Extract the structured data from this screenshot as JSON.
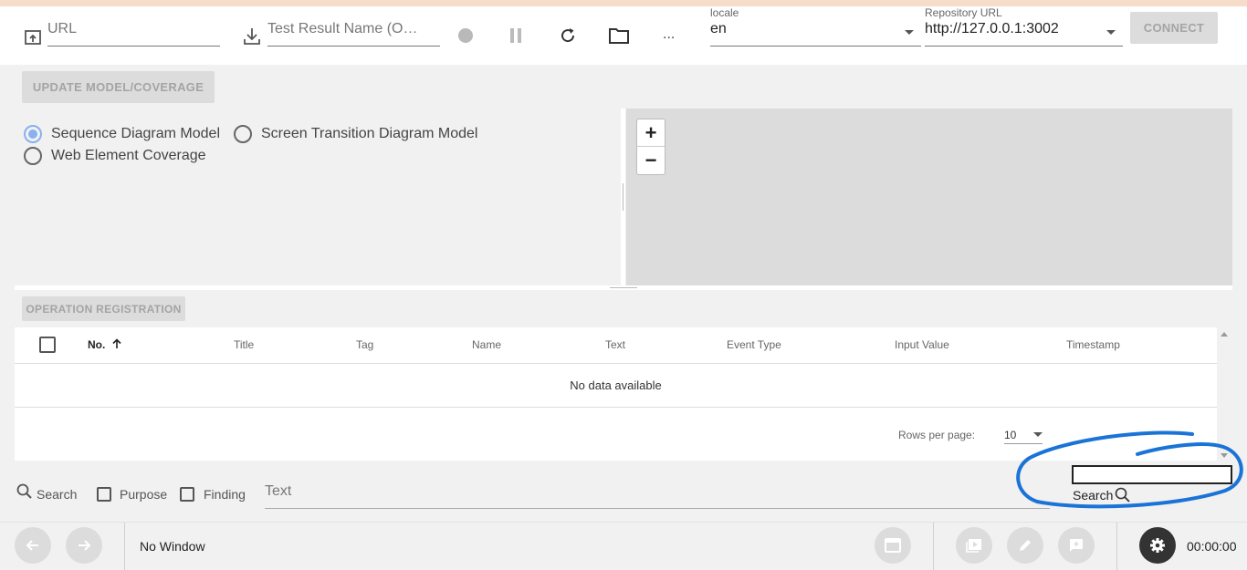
{
  "toolbar": {
    "url_placeholder": "URL",
    "test_result_placeholder": "Test Result Name  (O…",
    "more_label": "...",
    "locale_label": "locale",
    "locale_value": "en",
    "repo_label": "Repository URL",
    "repo_value": "http://127.0.0.1:3002",
    "connect_label": "CONNECT"
  },
  "model": {
    "update_label": "UPDATE MODEL/COVERAGE",
    "options": [
      {
        "label": "Sequence Diagram Model",
        "checked": true
      },
      {
        "label": "Screen Transition Diagram Model",
        "checked": false
      },
      {
        "label": "Web Element Coverage",
        "checked": false
      }
    ],
    "zoom_in": "+",
    "zoom_out": "−"
  },
  "operations": {
    "register_label": "OPERATION REGISTRATION",
    "columns": [
      "No.",
      "Title",
      "Tag",
      "Name",
      "Text",
      "Event Type",
      "Input Value",
      "Timestamp"
    ],
    "sort_icon": "arrow-up-icon",
    "empty_text": "No data available",
    "rows_per_page_label": "Rows per page:",
    "rows_per_page_value": "10"
  },
  "search_bar": {
    "search_label": "Search",
    "purpose_label": "Purpose",
    "finding_label": "Finding",
    "text_placeholder": "Text",
    "annotated_search_label": "Search"
  },
  "status": {
    "window_label": "No Window",
    "timer": "00:00:00"
  },
  "colors": {
    "accent": "#8ab0ee",
    "annotation": "#1a73d6",
    "disabled": "#dcdcdc",
    "settings_button": "#333333"
  }
}
